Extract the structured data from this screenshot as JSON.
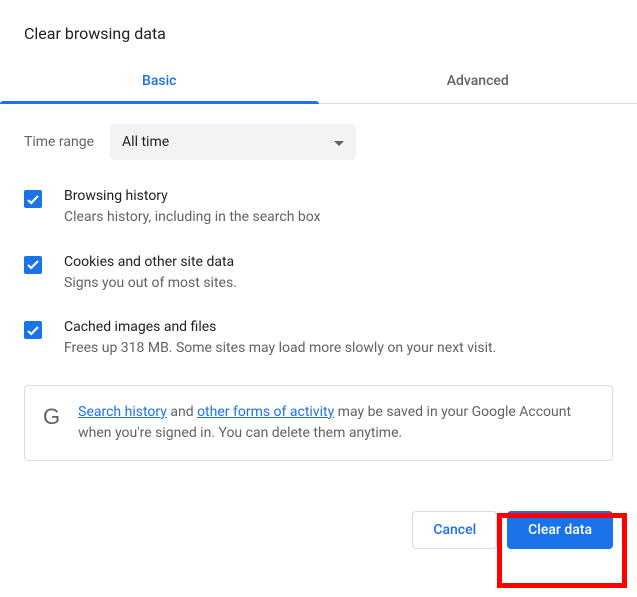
{
  "title": "Clear browsing data",
  "tabs": {
    "basic": "Basic",
    "advanced": "Advanced"
  },
  "time": {
    "label": "Time range",
    "value": "All time"
  },
  "options": [
    {
      "title": "Browsing history",
      "desc": "Clears history, including in the search box"
    },
    {
      "title": "Cookies and other site data",
      "desc": "Signs you out of most sites."
    },
    {
      "title": "Cached images and files",
      "desc": "Frees up 318 MB. Some sites may load more slowly on your next visit."
    }
  ],
  "notice": {
    "link1": "Search history",
    "mid1": " and ",
    "link2": "other forms of activity",
    "rest": " may be saved in your Google Account when you're signed in. You can delete them anytime."
  },
  "buttons": {
    "cancel": "Cancel",
    "clear": "Clear data"
  },
  "glyphs": {
    "g": "G"
  }
}
